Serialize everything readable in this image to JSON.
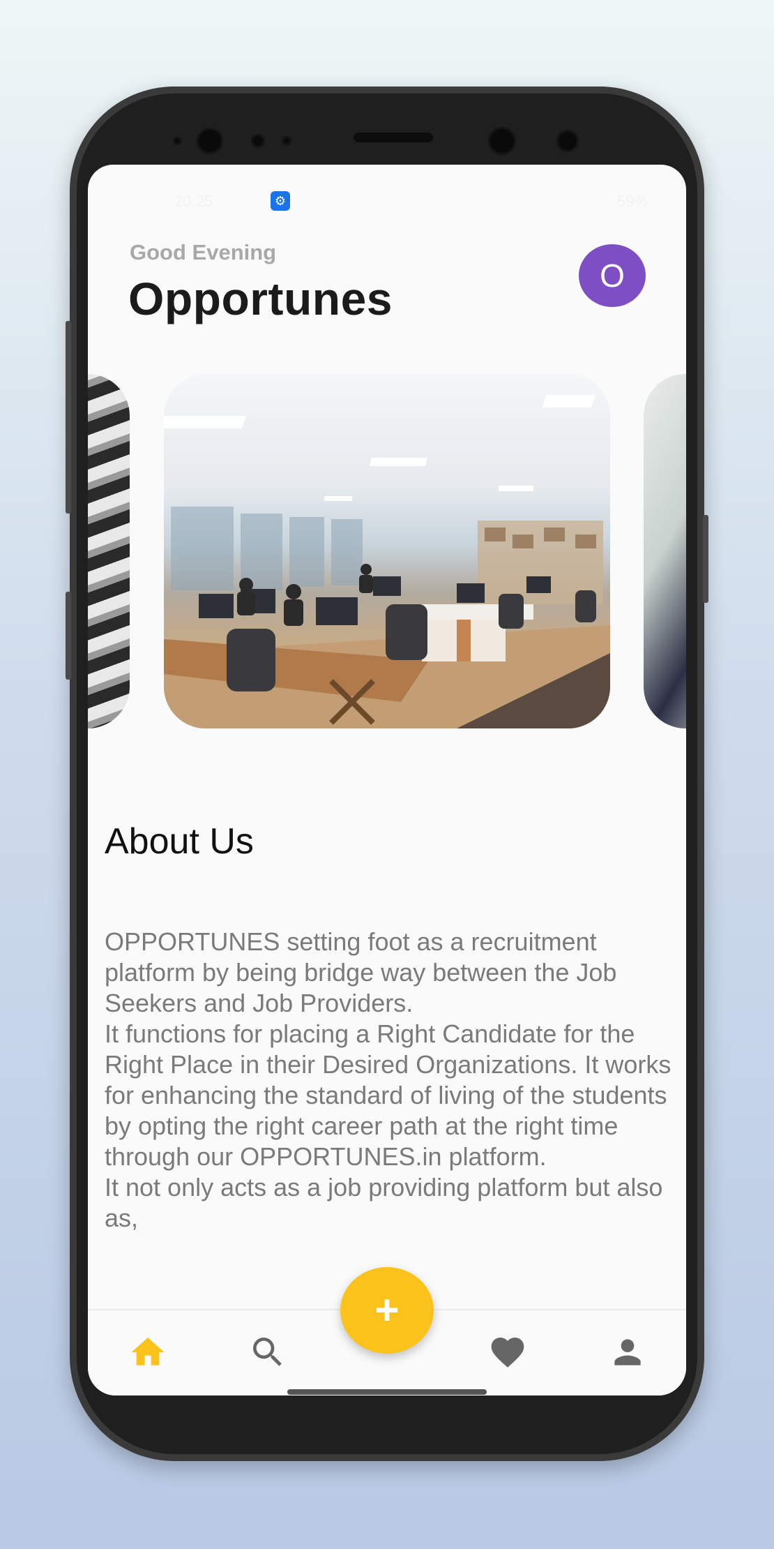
{
  "status_bar": {
    "time": "20:25",
    "right": "59%"
  },
  "header": {
    "greeting": "Good Evening",
    "title": "Opportunes",
    "avatar_initial": "O"
  },
  "carousel": {
    "slides": [
      "staircase-image",
      "office-workspace-image",
      "meeting-image"
    ],
    "active_index": 1
  },
  "about": {
    "heading": "About Us",
    "body": "OPPORTUNES setting foot as a recruitment platform by being bridge way between the Job Seekers and Job Providers.\nIt functions for placing a Right Candidate for the Right Place in their Desired Organizations. It works for enhancing the standard of living of the students by opting the right career path at the right time through our OPPORTUNES.in platform.\nIt not only acts as a job providing platform but also as,"
  },
  "fab": {
    "icon": "plus-icon",
    "label": "+"
  },
  "bottom_nav": {
    "items": [
      {
        "name": "home",
        "icon": "home-icon",
        "active": true
      },
      {
        "name": "search",
        "icon": "search-icon",
        "active": false
      },
      {
        "name": "favorites",
        "icon": "heart-icon",
        "active": false
      },
      {
        "name": "profile",
        "icon": "person-icon",
        "active": false
      }
    ]
  },
  "colors": {
    "accent": "#fbc21b",
    "avatar": "#7e4fc4",
    "inactive_icon": "#666666"
  }
}
